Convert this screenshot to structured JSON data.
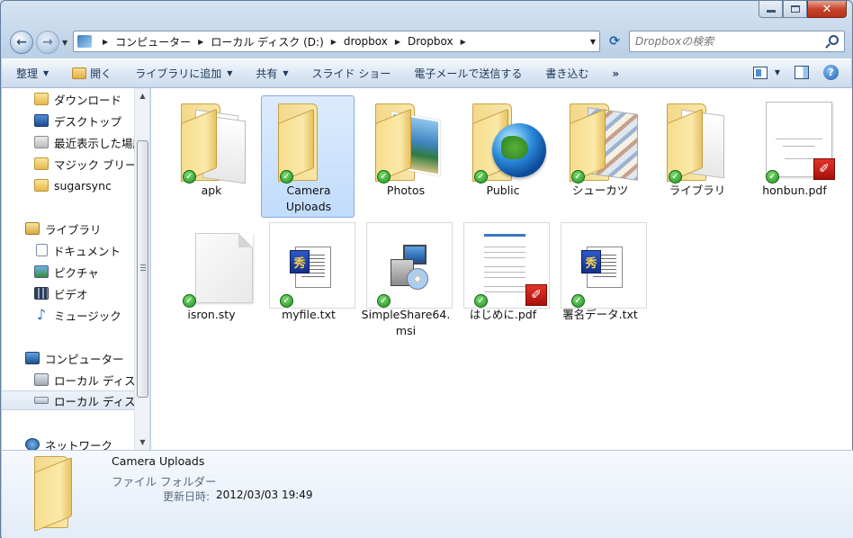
{
  "window": {
    "caption_buttons": {
      "minimize": "",
      "maximize": "",
      "close": "✕"
    }
  },
  "nav": {
    "back_icon": "back-arrow-icon",
    "forward_icon": "forward-arrow-icon"
  },
  "address": {
    "crumbs": [
      "コンピューター",
      "ローカル ディスク (D:)",
      "dropbox",
      "Dropbox"
    ],
    "dropdown": "▼",
    "refresh": "⟳"
  },
  "search": {
    "placeholder": "Dropboxの検索"
  },
  "commands": {
    "organize": "整理",
    "open": "開く",
    "add_to_library": "ライブラリに追加",
    "share": "共有",
    "slideshow": "スライド ショー",
    "email": "電子メールで送信する",
    "burn": "書き込む",
    "more": "»",
    "help": "?"
  },
  "sidebar": {
    "items": [
      {
        "label": "ダウンロード",
        "icon": "downloads-folder-icon"
      },
      {
        "label": "デスクトップ",
        "icon": "desktop-icon"
      },
      {
        "label": "最近表示した場所",
        "icon": "recent-places-icon"
      },
      {
        "label": "マジック ブリーフケース",
        "icon": "briefcase-folder-icon"
      },
      {
        "label": "sugarsync",
        "icon": "folder-icon"
      },
      {
        "label": "ライブラリ",
        "icon": "library-icon"
      },
      {
        "label": "ドキュメント",
        "icon": "documents-icon"
      },
      {
        "label": "ピクチャ",
        "icon": "pictures-icon"
      },
      {
        "label": "ビデオ",
        "icon": "videos-icon"
      },
      {
        "label": "ミュージック",
        "icon": "music-icon"
      },
      {
        "label": "コンピューター",
        "icon": "computer-icon"
      },
      {
        "label": "ローカル ディスク (C:)",
        "icon": "drive-c-icon"
      },
      {
        "label": "ローカル ディスク (D:)",
        "icon": "drive-d-icon"
      },
      {
        "label": "ネットワーク",
        "icon": "network-icon"
      }
    ]
  },
  "files": [
    {
      "name": "apk",
      "type": "folder"
    },
    {
      "name": "Camera\nUploads",
      "type": "folder",
      "selected": true
    },
    {
      "name": "Photos",
      "type": "folder-photos"
    },
    {
      "name": "Public",
      "type": "folder-globe"
    },
    {
      "name": "シューカツ",
      "type": "folder-collage"
    },
    {
      "name": "ライブラリ",
      "type": "folder"
    },
    {
      "name": "honbun.pdf",
      "type": "pdf"
    },
    {
      "name": "isron.sty",
      "type": "plain"
    },
    {
      "name": "myfile.txt",
      "type": "txt"
    },
    {
      "name": "SimpleShare64.\nmsi",
      "type": "msi"
    },
    {
      "name": "はじめに.pdf",
      "type": "pdf"
    },
    {
      "name": "署名データ.txt",
      "type": "txt"
    }
  ],
  "details": {
    "name": "Camera Uploads",
    "type": "ファイル フォルダー",
    "date_label": "更新日時:",
    "date_value": "2012/03/03 19:49"
  }
}
